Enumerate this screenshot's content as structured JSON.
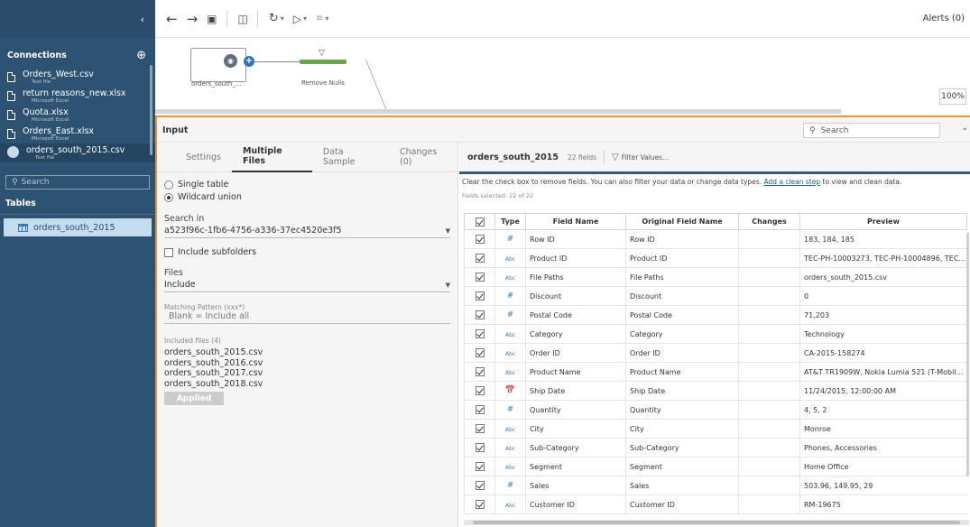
{
  "sidebar": {
    "collapse_icon": "chevron-left-icon",
    "connections_title": "Connections",
    "add_icon": "plus-circle-icon",
    "connections": [
      {
        "name": "Orders_West.csv",
        "sub": "Text file"
      },
      {
        "name": "return reasons_new.xlsx",
        "sub": "Microsoft Excel"
      },
      {
        "name": "Quota.xlsx",
        "sub": "Microsoft Excel"
      },
      {
        "name": "Orders_East.xlsx",
        "sub": "Microsoft Excel"
      },
      {
        "name": "orders_south_2015.csv",
        "sub": "Text file"
      }
    ],
    "search_placeholder": "Search",
    "tables_title": "Tables",
    "table_item": "orders_south_2015"
  },
  "toolbar": {
    "alerts": "Alerts (0)"
  },
  "flow": {
    "node1_label": "orders_south_...",
    "node2_label": "Remove Nulls",
    "zoom": "100%"
  },
  "input": {
    "title": "Input",
    "search_placeholder": "Search"
  },
  "settings": {
    "tabs": [
      "Settings",
      "Multiple Files",
      "Data Sample",
      "Changes (0)"
    ],
    "single_table": "Single table",
    "wildcard_union": "Wildcard union",
    "search_in_label": "Search in",
    "search_in_value": "a523f96c-1fb6-4756-a336-37ec4520e3f5",
    "include_subfolders": "Include subfolders",
    "files_label": "Files",
    "files_value": "Include",
    "matching_label": "Matching Pattern (xxx*)",
    "matching_placeholder": "Blank = Include all",
    "included_label": "Included files (4)",
    "included_files": [
      "orders_south_2015.csv",
      "orders_south_2016.csv",
      "orders_south_2017.csv",
      "orders_south_2018.csv"
    ],
    "applied": "Applied"
  },
  "fields": {
    "name": "orders_south_2015",
    "count": "22 fields",
    "filter": "Filter Values...",
    "info_pre": "Clear the check box to remove fields. You can also filter your data or change data types.",
    "info_link": "Add a clean step",
    "info_post": "to view and clean data.",
    "selected": "Fields selected: 22 of 22",
    "headers": [
      "Type",
      "Field Name",
      "Original Field Name",
      "Changes",
      "Preview"
    ],
    "rows": [
      {
        "type": "#",
        "name": "Row ID",
        "orig": "Row ID",
        "changes": "",
        "preview": "183, 184, 185"
      },
      {
        "type": "Abc",
        "name": "Product ID",
        "orig": "Product ID",
        "changes": "",
        "preview": "TEC-PH-10003273, TEC-PH-10004896, TEC-..."
      },
      {
        "type": "Abc",
        "name": "File Paths",
        "orig": "File Paths",
        "changes": "",
        "preview": "orders_south_2015.csv"
      },
      {
        "type": "#",
        "name": "Discount",
        "orig": "Discount",
        "changes": "",
        "preview": "0"
      },
      {
        "type": "#",
        "name": "Postal Code",
        "orig": "Postal Code",
        "changes": "",
        "preview": "71,203"
      },
      {
        "type": "Abc",
        "name": "Category",
        "orig": "Category",
        "changes": "",
        "preview": "Technology"
      },
      {
        "type": "Abc",
        "name": "Order ID",
        "orig": "Order ID",
        "changes": "",
        "preview": "CA-2015-158274"
      },
      {
        "type": "Abc",
        "name": "Product Name",
        "orig": "Product Name",
        "changes": "",
        "preview": "AT&T TR1909W, Nokia Lumia 521 (T-Mobile)..."
      },
      {
        "type": "date",
        "name": "Ship Date",
        "orig": "Ship Date",
        "changes": "",
        "preview": "11/24/2015, 12:00:00 AM"
      },
      {
        "type": "#",
        "name": "Quantity",
        "orig": "Quantity",
        "changes": "",
        "preview": "4, 5, 2"
      },
      {
        "type": "Abc",
        "name": "City",
        "orig": "City",
        "changes": "",
        "preview": "Monroe"
      },
      {
        "type": "Abc",
        "name": "Sub-Category",
        "orig": "Sub-Category",
        "changes": "",
        "preview": "Phones, Accessories"
      },
      {
        "type": "Abc",
        "name": "Segment",
        "orig": "Segment",
        "changes": "",
        "preview": "Home Office"
      },
      {
        "type": "#",
        "name": "Sales",
        "orig": "Sales",
        "changes": "",
        "preview": "503.96, 149.95, 29"
      },
      {
        "type": "Abc",
        "name": "Customer ID",
        "orig": "Customer ID",
        "changes": "",
        "preview": "RM-19675"
      }
    ]
  }
}
